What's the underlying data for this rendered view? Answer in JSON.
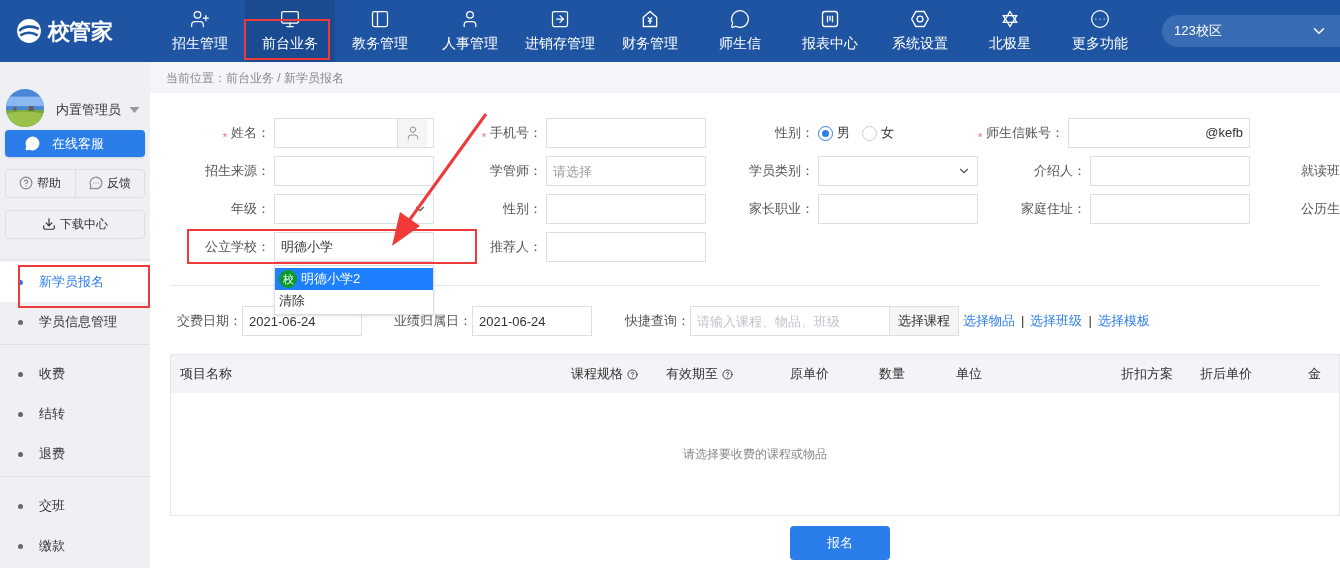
{
  "header": {
    "logo": "校管家",
    "campus": "123校区",
    "nav": [
      {
        "label": "招生管理",
        "selected": false
      },
      {
        "label": "前台业务",
        "selected": true
      },
      {
        "label": "教务管理",
        "selected": false
      },
      {
        "label": "人事管理",
        "selected": false
      },
      {
        "label": "进销存管理",
        "selected": false
      },
      {
        "label": "财务管理",
        "selected": false
      },
      {
        "label": "师生信",
        "selected": false
      },
      {
        "label": "报表中心",
        "selected": false
      },
      {
        "label": "系统设置",
        "selected": false
      },
      {
        "label": "北极星",
        "selected": false
      },
      {
        "label": "更多功能",
        "selected": false
      }
    ]
  },
  "sidebar": {
    "user": "内置管理员",
    "service_button": "在线客服",
    "help_button": "帮助",
    "feedback_button": "反馈",
    "download_button": "下载中心",
    "menu_groups": [
      [
        {
          "label": "新学员报名",
          "selected": true
        },
        {
          "label": "学员信息管理",
          "selected": false
        }
      ],
      [
        {
          "label": "收费",
          "selected": false
        },
        {
          "label": "结转",
          "selected": false
        },
        {
          "label": "退费",
          "selected": false
        }
      ],
      [
        {
          "label": "交班",
          "selected": false
        },
        {
          "label": "缴款",
          "selected": false
        }
      ]
    ]
  },
  "breadcrumb": "当前位置：前台业务 / 新学员报名",
  "form": {
    "rows": [
      [
        {
          "kind": "picker",
          "label": "姓名：",
          "required_mark": "*"
        },
        {
          "kind": "text",
          "label": "手机号：",
          "required_mark": "*"
        },
        {
          "kind": "radio",
          "label": "性别：",
          "options": [
            {
              "label": "男",
              "selected": true
            },
            {
              "label": "女",
              "selected": false
            }
          ]
        },
        {
          "kind": "account",
          "label": "师生信账号：",
          "required_mark": "*",
          "suffix": "@kefb"
        }
      ],
      [
        {
          "kind": "text",
          "label": "招生来源："
        },
        {
          "kind": "text",
          "label": "学管师：",
          "placeholder": "请选择"
        },
        {
          "kind": "select",
          "label": "学员类别："
        },
        {
          "kind": "text",
          "label": "介绍人："
        },
        {
          "kind": "label",
          "label": "就读班"
        }
      ],
      [
        {
          "kind": "select",
          "label": "年级："
        },
        {
          "kind": "text",
          "label": "性别："
        },
        {
          "kind": "text",
          "label": "家长职业："
        },
        {
          "kind": "text",
          "label": "家庭住址："
        },
        {
          "kind": "label",
          "label": "公历生"
        }
      ],
      [
        {
          "kind": "text",
          "label": "公立学校：",
          "value": "明德小学"
        },
        {
          "kind": "text",
          "label": "推荐人："
        }
      ]
    ],
    "school_dropdown": [
      {
        "label": "明德小学2",
        "badge": "校",
        "selected": true
      },
      {
        "label": "清除",
        "selected": false
      }
    ]
  },
  "payment": {
    "date_label": "交费日期：",
    "date": "2021-06-24",
    "perf_label": "业绩归属日：",
    "perf_date": "2021-06-24",
    "search_label": "快捷查询：",
    "search_placeholder": "请输入课程、物品、班级",
    "course_button": "选择课程",
    "links": [
      {
        "kind": "link",
        "label": "选择物品"
      },
      {
        "kind": "separator",
        "label": "|"
      },
      {
        "kind": "link",
        "label": "选择班级"
      },
      {
        "kind": "separator",
        "label": "|"
      },
      {
        "kind": "link",
        "label": "选择模板"
      }
    ]
  },
  "table": {
    "columns": [
      {
        "label": "项目名称",
        "help": false
      },
      {
        "label": "课程规格",
        "help": true
      },
      {
        "label": "有效期至",
        "help": true
      },
      {
        "label": "原单价",
        "help": false
      },
      {
        "label": "数量",
        "help": false
      },
      {
        "label": "单位",
        "help": false
      },
      {
        "label": "折扣方案",
        "help": false
      },
      {
        "label": "折后单价",
        "help": false
      },
      {
        "label": "金",
        "help": false
      }
    ],
    "empty_text": "请选择要收费的课程或物品"
  },
  "submit": "报名"
}
